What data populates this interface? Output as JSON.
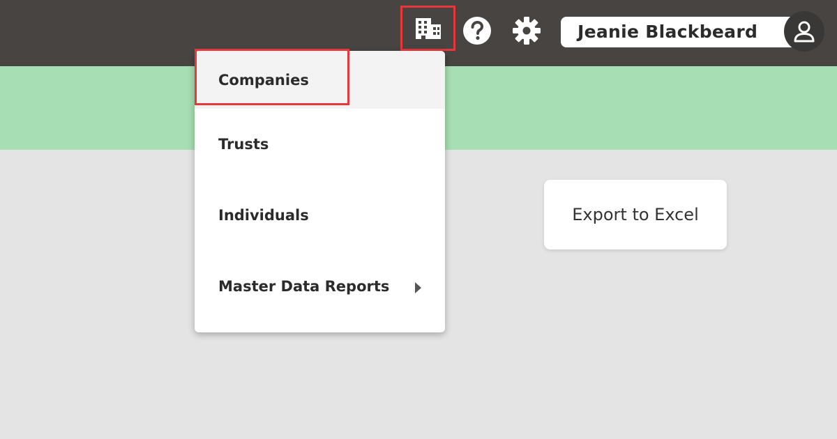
{
  "topbar": {
    "icons": {
      "organization": "building-icon",
      "help": "help-circle-icon",
      "settings": "gear-icon",
      "avatar": "user-icon"
    },
    "user_name": "Jeanie Blackbeard"
  },
  "menu": {
    "items": [
      {
        "label": "Companies",
        "active": true
      },
      {
        "label": "Trusts"
      },
      {
        "label": "Individuals"
      },
      {
        "label": "Master Data Reports",
        "has_submenu": true
      }
    ]
  },
  "actions": {
    "export_label": "Export to Excel"
  },
  "colors": {
    "topbar": "#474441",
    "banner": "#a7deb3",
    "background": "#e4e4e4",
    "highlight": "#e8373a"
  }
}
